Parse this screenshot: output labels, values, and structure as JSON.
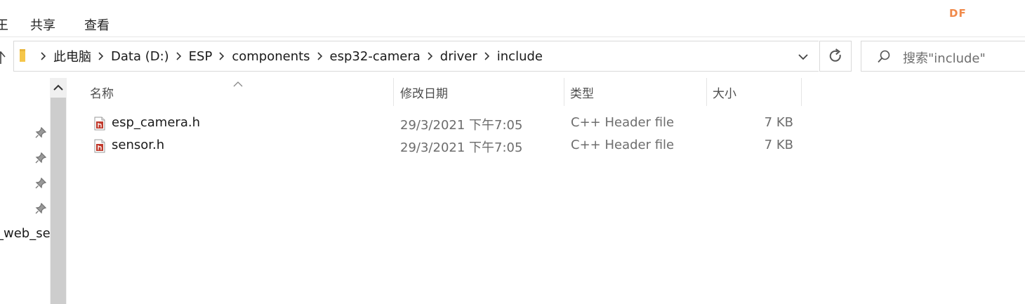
{
  "ribbon": {
    "partial_tab": "王",
    "tabs": [
      "共享",
      "查看"
    ],
    "brand": "DF"
  },
  "address": {
    "crumbs": [
      "此电脑",
      "Data (D:)",
      "ESP",
      "components",
      "esp32-camera",
      "driver",
      "include"
    ]
  },
  "search": {
    "placeholder": "搜索\"include\""
  },
  "nav": {
    "partial_item": "_web_se"
  },
  "columns": {
    "name": "名称",
    "date": "修改日期",
    "type": "类型",
    "size": "大小"
  },
  "files": [
    {
      "name": "esp_camera.h",
      "date": "29/3/2021 下午7:05",
      "type": "C++ Header file",
      "size": "7 KB"
    },
    {
      "name": "sensor.h",
      "date": "29/3/2021 下午7:05",
      "type": "C++ Header file",
      "size": "7 KB"
    }
  ],
  "colors": {
    "brand": "#f08a4b",
    "file_icon": "#c0392b",
    "folder": "#f5c64a"
  }
}
